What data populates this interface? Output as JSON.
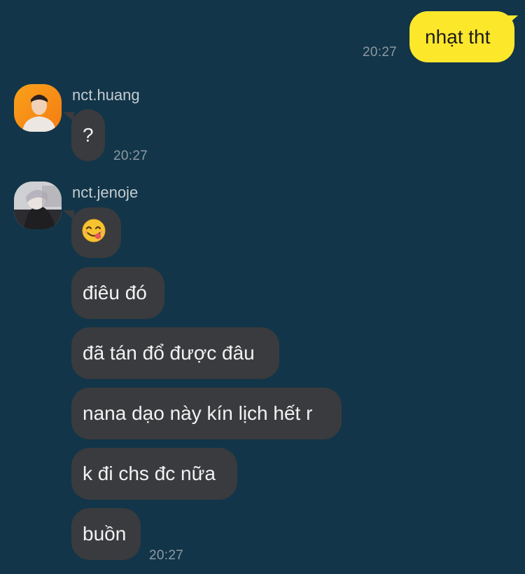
{
  "chat": {
    "outgoing": [
      {
        "text": "nhạt tht",
        "time": "20:27"
      }
    ],
    "senders": [
      {
        "name": "nct.huang",
        "avatar_icon": "profile-photo-orange-icon",
        "messages": [
          {
            "text": "?"
          }
        ],
        "time": "20:27"
      },
      {
        "name": "nct.jenoje",
        "avatar_icon": "profile-photo-mono-icon",
        "messages": [
          {
            "text": "😋",
            "emoji_name": "face-savoring-food-icon"
          },
          {
            "text": "điêu đó"
          },
          {
            "text": "đã tán đổ được đâu"
          },
          {
            "text": "nana dạo này kín lịch hết r"
          },
          {
            "text": "k đi chs đc nữa"
          },
          {
            "text": "buồn"
          }
        ],
        "time": "20:27"
      }
    ]
  },
  "colors": {
    "background": "#123549",
    "outgoing_bubble": "#fde72b",
    "incoming_bubble": "#3a3b3e",
    "timestamp": "#8e9aa3"
  }
}
